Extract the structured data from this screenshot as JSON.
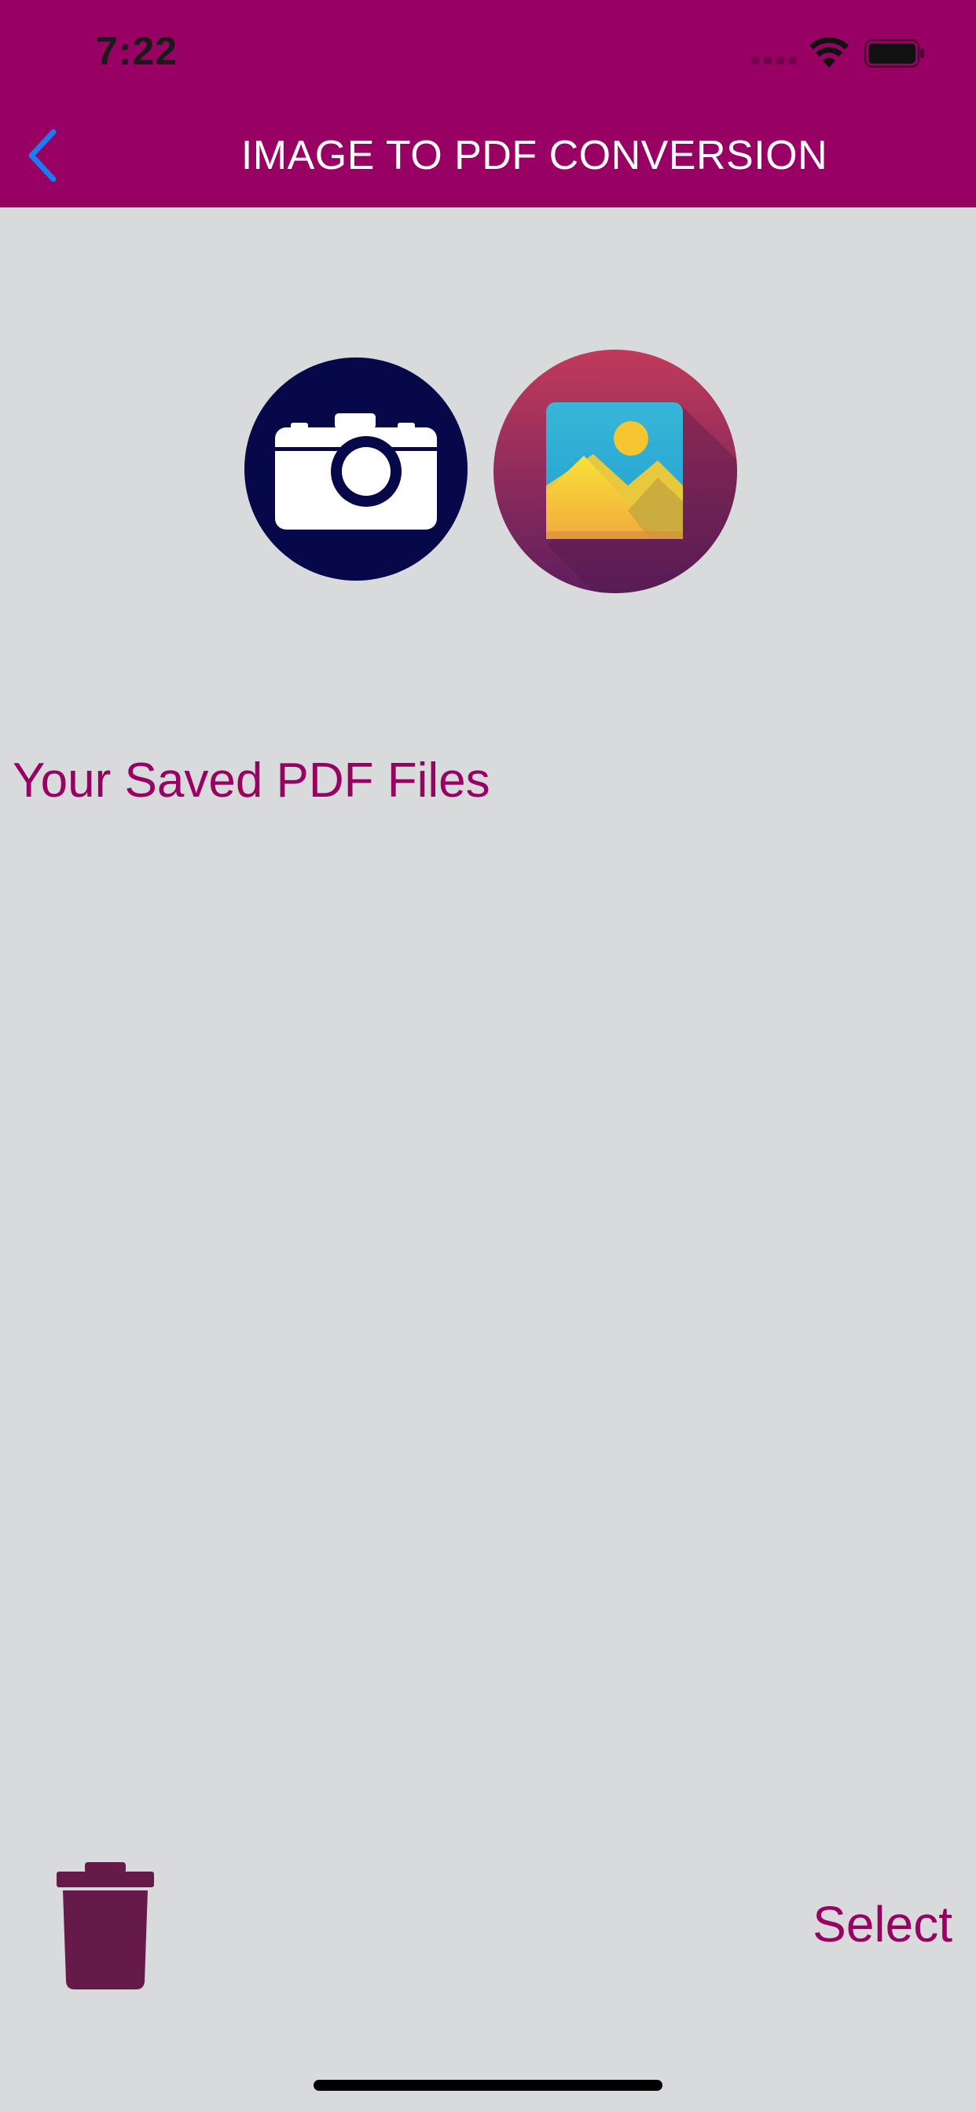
{
  "status_bar": {
    "time": "7:22"
  },
  "nav_bar": {
    "title": "IMAGE TO PDF CONVERSION",
    "back_icon": "chevron-left-icon",
    "color": "#990063",
    "back_color": "#1a7cf0"
  },
  "actions": {
    "camera_icon": "camera-icon",
    "gallery_icon": "photo-gallery-icon"
  },
  "saved_files": {
    "heading": "Your Saved PDF Files",
    "items": []
  },
  "toolbar": {
    "delete_icon": "trash-icon",
    "select_label": "Select"
  },
  "theme": {
    "background": "#d9dadb",
    "accent": "#990063",
    "trash_color": "#661a49"
  }
}
